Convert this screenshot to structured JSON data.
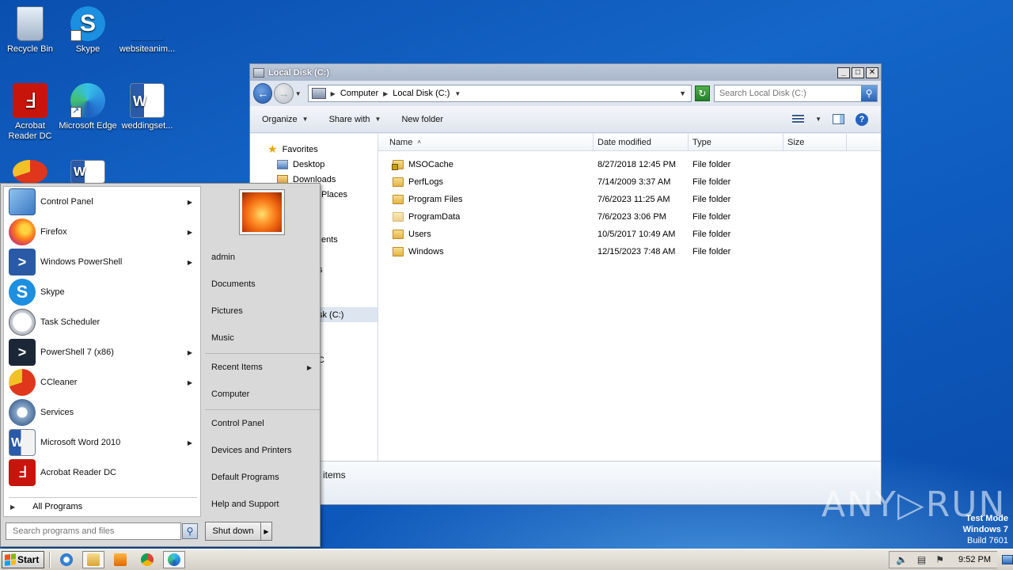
{
  "desktop": {
    "icons": [
      {
        "label": "Recycle Bin",
        "icon": "recycle-bin-icon"
      },
      {
        "label": "Skype",
        "icon": "skype-icon"
      },
      {
        "label": "websiteanim...",
        "icon": "blank-file-icon"
      },
      {
        "label": "Acrobat Reader DC",
        "icon": "acrobat-icon"
      },
      {
        "label": "Microsoft Edge",
        "icon": "edge-icon"
      },
      {
        "label": "weddingset...",
        "icon": "word-doc-icon"
      }
    ],
    "watermark": {
      "line1": "Test Mode",
      "line2": "Windows 7",
      "line3": "Build 7601"
    },
    "anyrun": "ANY▷RUN"
  },
  "explorer": {
    "title": "Local Disk (C:)",
    "address": {
      "crumbs": [
        "Computer",
        "Local Disk (C:)"
      ]
    },
    "search_placeholder": "Search Local Disk (C:)",
    "commands": {
      "organize": "Organize",
      "share": "Share with",
      "new_folder": "New folder"
    },
    "nav": {
      "favorites": "Favorites",
      "desktop": "Desktop",
      "downloads": "Downloads",
      "recent": "Places",
      "partial_documents": "ents",
      "partial_s": "s",
      "partial_disk": "sk (C:)",
      "partial_c": "C"
    },
    "columns": {
      "name": "Name",
      "date": "Date modified",
      "type": "Type",
      "size": "Size"
    },
    "files": [
      {
        "name": "MSOCache",
        "date": "8/27/2018 12:45 PM",
        "type": "File folder",
        "locked": true
      },
      {
        "name": "PerfLogs",
        "date": "7/14/2009 3:37 AM",
        "type": "File folder",
        "locked": false
      },
      {
        "name": "Program Files",
        "date": "7/6/2023 11:25 AM",
        "type": "File folder",
        "locked": false
      },
      {
        "name": "ProgramData",
        "date": "7/6/2023 3:06 PM",
        "type": "File folder",
        "locked": false
      },
      {
        "name": "Users",
        "date": "10/5/2017 10:49 AM",
        "type": "File folder",
        "locked": false
      },
      {
        "name": "Windows",
        "date": "12/15/2023 7:48 AM",
        "type": "File folder",
        "locked": false
      }
    ],
    "details": "items"
  },
  "start_menu": {
    "programs": [
      {
        "label": "Control Panel",
        "icon": "control-panel-icon",
        "arrow": true
      },
      {
        "label": "Firefox",
        "icon": "firefox-icon",
        "arrow": true
      },
      {
        "label": "Windows PowerShell",
        "icon": "powershell-icon",
        "arrow": true
      },
      {
        "label": "Skype",
        "icon": "skype-icon",
        "arrow": false
      },
      {
        "label": "Task Scheduler",
        "icon": "task-scheduler-icon",
        "arrow": false
      },
      {
        "label": "PowerShell 7 (x86)",
        "icon": "powershell7-icon",
        "arrow": true
      },
      {
        "label": "CCleaner",
        "icon": "ccleaner-icon",
        "arrow": true
      },
      {
        "label": "Services",
        "icon": "services-icon",
        "arrow": false
      },
      {
        "label": "Microsoft Word 2010",
        "icon": "word-icon",
        "arrow": true
      },
      {
        "label": "Acrobat Reader DC",
        "icon": "acrobat-icon",
        "arrow": false
      }
    ],
    "all_programs": "All Programs",
    "search_placeholder": "Search programs and files",
    "right": {
      "user": "admin",
      "documents": "Documents",
      "pictures": "Pictures",
      "music": "Music",
      "recent_items": "Recent Items",
      "computer": "Computer",
      "control_panel": "Control Panel",
      "devices": "Devices and Printers",
      "default_programs": "Default Programs",
      "help": "Help and Support"
    },
    "shutdown": "Shut down"
  },
  "taskbar": {
    "start": "Start",
    "clock": "9:52 PM"
  }
}
